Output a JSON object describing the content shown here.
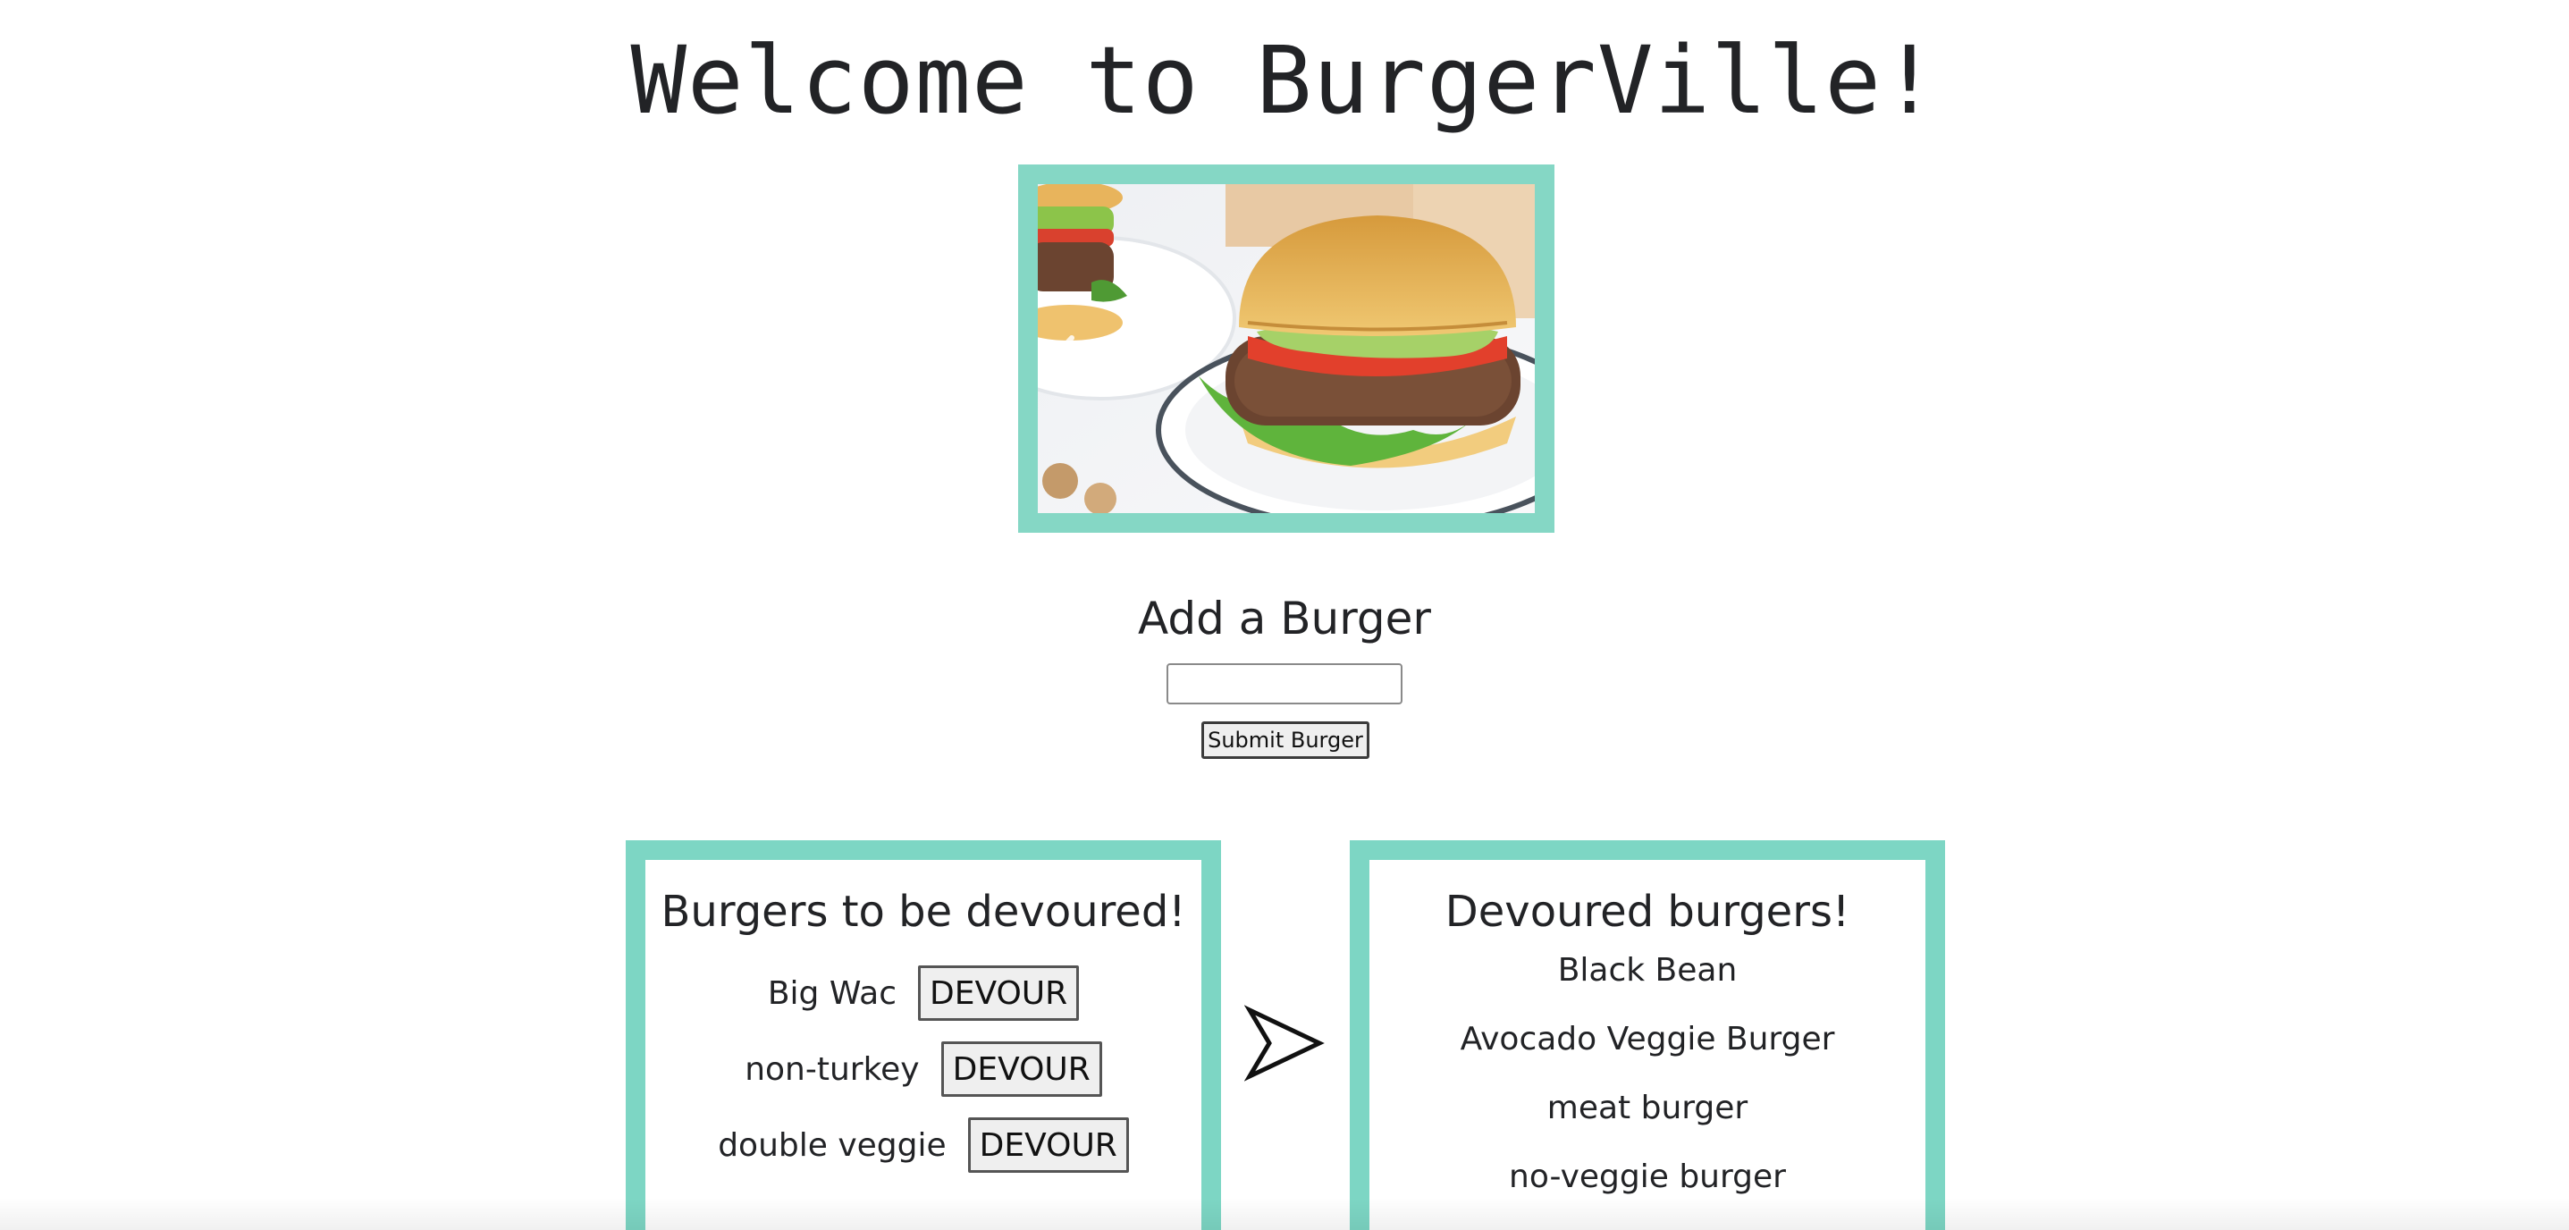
{
  "header": {
    "title": "Welcome to BurgerVille!"
  },
  "carousel": {
    "image_name": "veggie-burger-photo",
    "prev_icon": "chevron-left-icon"
  },
  "add_form": {
    "heading": "Add a Burger",
    "input_value": "",
    "submit_label": "Submit Burger"
  },
  "to_devour": {
    "title": "Burgers to be devoured!",
    "button_label": "DEVOUR",
    "items": [
      {
        "name": "Big Wac"
      },
      {
        "name": "non-turkey"
      },
      {
        "name": "double veggie"
      }
    ]
  },
  "arrow_icon": "send-arrow-icon",
  "devoured": {
    "title": "Devoured burgers!",
    "items": [
      {
        "name": "Black Bean"
      },
      {
        "name": "Avocado Veggie Burger"
      },
      {
        "name": "meat burger"
      },
      {
        "name": "no-veggie burger"
      }
    ]
  },
  "colors": {
    "panel_border": "#7dd6c4",
    "carousel_border": "#85d7c5",
    "text": "#222326"
  }
}
